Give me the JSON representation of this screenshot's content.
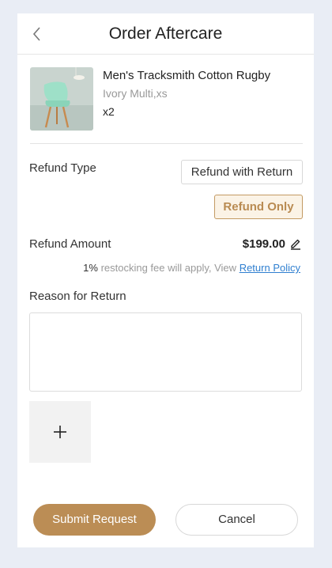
{
  "header": {
    "title": "Order Aftercare",
    "back_icon": "chevron-left-icon"
  },
  "product": {
    "name": "Men's Tracksmith Cotton Rugby",
    "variant": "Ivory Multi,xs",
    "quantity": "x2",
    "image": "mint-chair-photo"
  },
  "refund_type": {
    "label": "Refund Type",
    "options": [
      "Refund with Return",
      "Refund Only"
    ],
    "selected": "Refund Only"
  },
  "refund_amount": {
    "label": "Refund Amount",
    "value": "$199.00",
    "edit_icon": "pencil-edit-icon"
  },
  "restocking": {
    "percent": "1%",
    "text": "restocking fee will apply, View",
    "link": "Return Policy"
  },
  "reason": {
    "label": "Reason for Return",
    "value": ""
  },
  "upload": {
    "icon": "plus-icon"
  },
  "actions": {
    "submit": "Submit Request",
    "cancel": "Cancel"
  },
  "colors": {
    "accent": "#bb8d55",
    "link": "#2f7fd0",
    "background": "#e9edf5"
  }
}
